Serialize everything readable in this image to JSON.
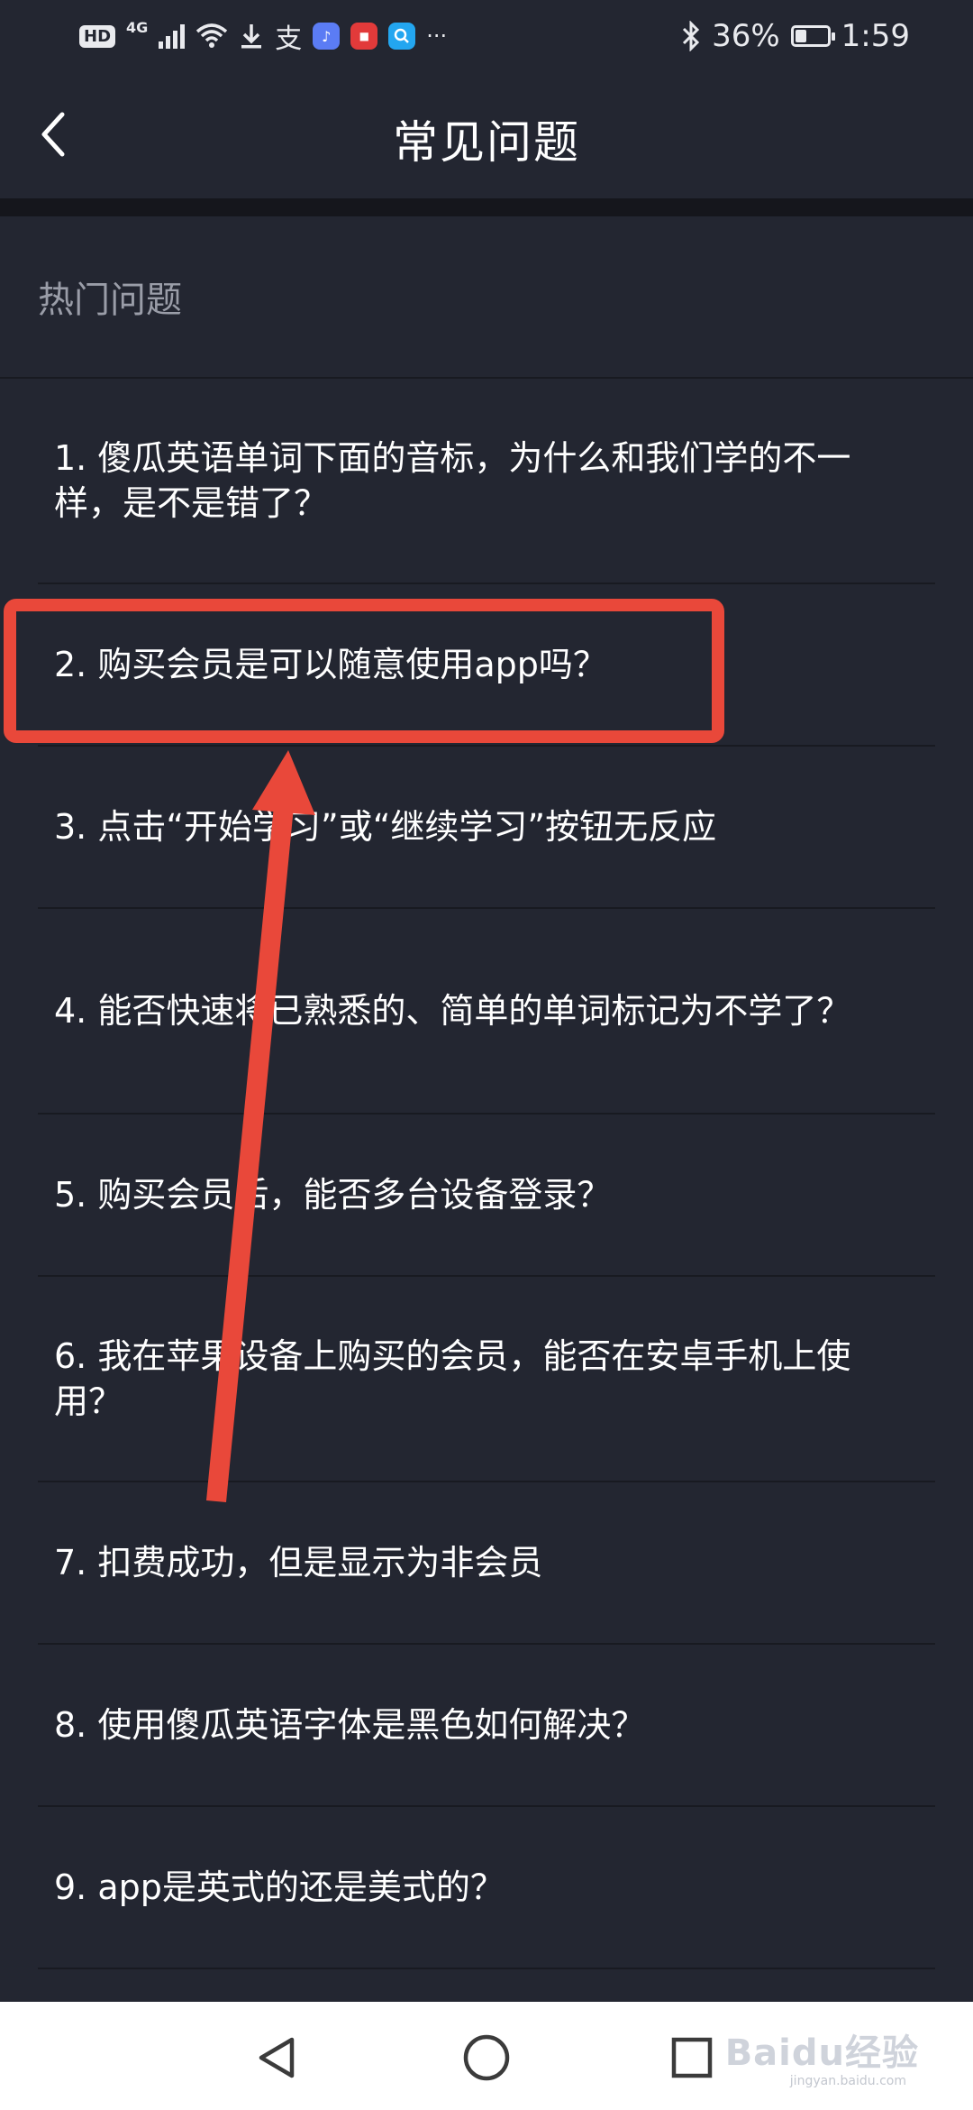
{
  "status_bar": {
    "hd": "HD",
    "network": "4G",
    "alipay_glyph": "支",
    "battery_percent": "36%",
    "battery_level": 0.36,
    "time": "1:59",
    "more": "···",
    "icons": [
      "signal-icon",
      "wifi-icon",
      "download-icon",
      "alipay-icon",
      "music-app-icon",
      "news-app-icon",
      "search-app-icon",
      "bluetooth-icon",
      "battery-charging-icon"
    ]
  },
  "header": {
    "title": "常见问题",
    "back_icon": "chevron-left-icon"
  },
  "section": {
    "title": "热门问题"
  },
  "faq": [
    {
      "text": "1. 傻瓜英语单词下面的音标，为什么和我们学的不一样，是不是错了？"
    },
    {
      "text": "2. 购买会员是可以随意使用app吗？"
    },
    {
      "text": "3. 点击“开始学习”或“继续学习”按钮无反应"
    },
    {
      "text": "4. 能否快速将已熟悉的、简单的单词标记为不学了？"
    },
    {
      "text": "5. 购买会员后，能否多台设备登录？"
    },
    {
      "text": "6. 我在苹果设备上购买的会员，能否在安卓手机上使用？"
    },
    {
      "text": "7. 扣费成功，但是显示为非会员"
    },
    {
      "text": "8. 使用傻瓜英语字体是黑色如何解决？"
    },
    {
      "text": "9. app是英式的还是美式的？"
    }
  ],
  "annotation": {
    "color": "#e9483a",
    "highlighted_item": 2
  },
  "nav_bar": {
    "buttons": [
      "back-triangle-icon",
      "home-circle-icon",
      "recents-square-icon"
    ],
    "watermark": "Baidu经验",
    "watermark_sub": "jingyan.baidu.com"
  },
  "colors": {
    "background": "#232631",
    "text": "#ffffff",
    "section_title": "#9a9da8",
    "divider": "#181a21"
  }
}
